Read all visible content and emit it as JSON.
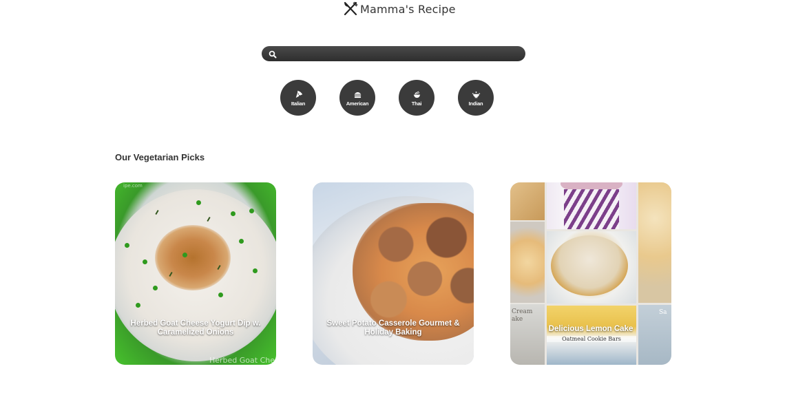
{
  "header": {
    "title": "Mamma's Recipe",
    "logo_icon": "fork-knife-icon"
  },
  "search": {
    "placeholder": "",
    "value": "",
    "icon": "search-icon"
  },
  "categories": [
    {
      "label": "Italian",
      "icon": "pizza-icon"
    },
    {
      "label": "American",
      "icon": "burger-icon"
    },
    {
      "label": "Thai",
      "icon": "noodle-bowl-icon"
    },
    {
      "label": "Indian",
      "icon": "curry-bowl-icon"
    }
  ],
  "section": {
    "title": "Our Vegetarian Picks"
  },
  "cards": [
    {
      "title": "Herbed Goat Cheese Yogurt Dip w. Caramelized Onions",
      "image_watermark": "Herbed Goat Che",
      "image_corner_text": "ipe.com"
    },
    {
      "title": "Sweet Potato Casserole Gourmet & Holiday Baking"
    },
    {
      "title": "Delicious Lemon Cake",
      "image_text_left": "Cream\nake",
      "image_text_center": "Oatmeal Cookie Bars",
      "image_text_right": "Sa"
    }
  ],
  "colors": {
    "accent_dark": "#3b3b3b",
    "search_bg": "#3a3a3a",
    "background": "#ffffff"
  }
}
